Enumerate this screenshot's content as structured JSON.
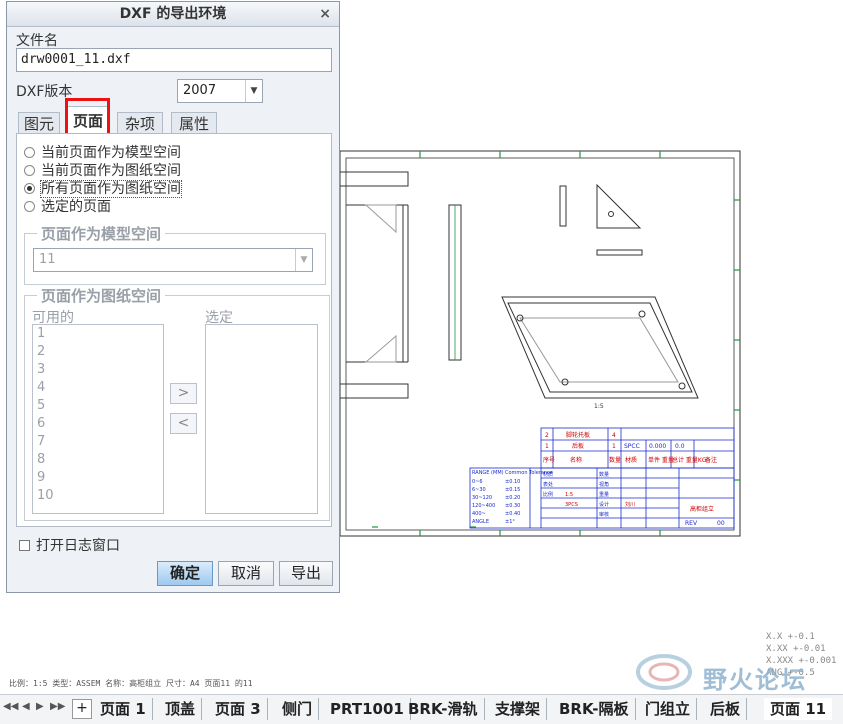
{
  "dialog": {
    "title": "DXF 的导出环境",
    "close_glyph": "×",
    "filename_label": "文件名",
    "filename_value": "drw0001_11.dxf",
    "version_label": "DXF版本",
    "version_value": "2007",
    "tabs": [
      {
        "label": "图元"
      },
      {
        "label": "页面"
      },
      {
        "label": "杂项"
      },
      {
        "label": "属性"
      }
    ],
    "active_tab": "页面",
    "radios": [
      {
        "label": "当前页面作为模型空间",
        "selected": false
      },
      {
        "label": "当前页面作为图纸空间",
        "selected": false
      },
      {
        "label": "所有页面作为图纸空间",
        "selected": true
      },
      {
        "label": "选定的页面",
        "selected": false
      }
    ],
    "model_group": {
      "title": "页面作为模型空间",
      "combo_value": "11"
    },
    "paper_group": {
      "title": "页面作为图纸空间",
      "available_label": "可用的",
      "selected_label": "选定",
      "available_items": [
        "1",
        "2",
        "3",
        "4",
        "5",
        "6",
        "7",
        "8",
        "9",
        "10"
      ],
      "move_right": ">",
      "move_left": "<"
    },
    "log_checkbox_label": "打开日志窗口",
    "buttons": {
      "ok": "确定",
      "cancel": "取消",
      "export": "导出"
    }
  },
  "drawing": {
    "scale_label": "1:5",
    "status_line": "比例：1:5      类型：ASSEM      名称：高柜组立      尺寸：A4      页面11 的11",
    "title_block": {
      "part_name": "高柜组立",
      "rev_label": "REV",
      "rev_value": "00",
      "row1": [
        "2",
        "脚轮托板",
        "4"
      ],
      "row2": [
        "1",
        "后板",
        "1",
        "SPCC",
        "0.000",
        "0.0"
      ],
      "header": [
        "序号",
        "名称",
        "数量",
        "材质",
        "单件 重量",
        "总计 重量KG",
        "备注"
      ],
      "tolerance_header": [
        "RANGE (MM)",
        "Common Tolerance"
      ],
      "tolerance_rows": [
        [
          "0~6",
          "±0.10"
        ],
        [
          "6~30",
          "±0.15"
        ],
        [
          "30~120",
          "±0.20"
        ],
        [
          "120~400",
          "±0.30"
        ],
        [
          "400~",
          "±0.40"
        ],
        [
          "ANGLE",
          "±1°"
        ]
      ],
      "fields": [
        "材质",
        "数量",
        "表处",
        "比例",
        "重量",
        "视角",
        "设计",
        "审核",
        "1:5",
        "3PCS",
        "刘川"
      ]
    },
    "tolerance_legend": [
      "X.X     +-0.1",
      "X.XX    +-0.01",
      "X.XXX  +-0.001",
      "ANG    +-0.5"
    ]
  },
  "page_tabs": {
    "add_glyph": "+",
    "nav_glyphs": [
      "◀◀",
      "◀",
      "▶",
      "▶▶"
    ],
    "tabs": [
      "页面 1",
      "顶盖",
      "页面 3",
      "侧门",
      "PRT1001",
      "BRK-滑轨",
      "支撑架",
      "BRK-隔板",
      "门组立",
      "后板",
      "页面 11"
    ]
  },
  "watermark": {
    "text": "野火论坛"
  },
  "colors": {
    "frame_green": "#1a9a3a",
    "annotation_red": "#e11",
    "titleblock_blue": "#1a2ad0",
    "titleblock_red": "#c00"
  }
}
